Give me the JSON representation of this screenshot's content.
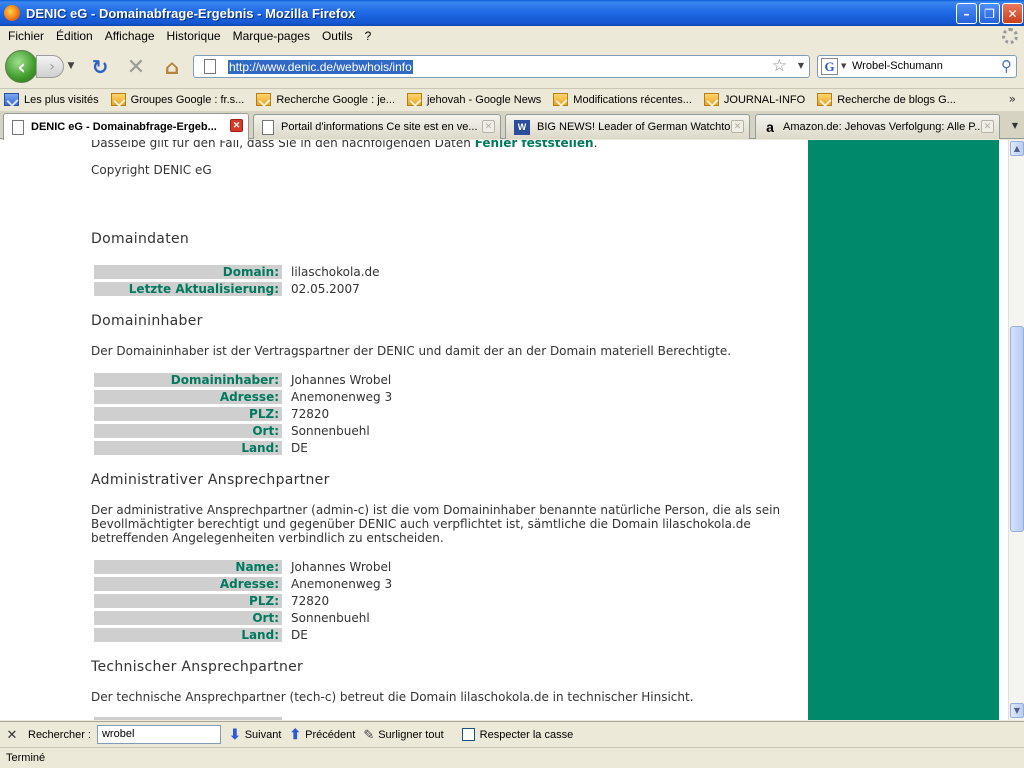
{
  "window": {
    "title": "DENIC eG - Domainabfrage-Ergebnis - Mozilla Firefox"
  },
  "menu": [
    "Fichier",
    "Édition",
    "Affichage",
    "Historique",
    "Marque-pages",
    "Outils",
    "?"
  ],
  "navigation": {
    "url": "http://www.denic.de/webwhois/info",
    "search_value": "Wrobel-Schumann",
    "search_engine_glyph": "G"
  },
  "bookmarks": [
    "Les plus visités",
    "Groupes Google : fr.s...",
    "Recherche Google : je...",
    "jehovah - Google News",
    "Modifications récentes...",
    "JOURNAL-INFO",
    "Recherche de blogs G..."
  ],
  "tabs": [
    {
      "label": "DENIC eG - Domainabfrage-Ergeb...",
      "active": true
    },
    {
      "label": "Portail d'informations Ce site est en ve...",
      "active": false
    },
    {
      "label": "BIG NEWS! Leader of German Watchto...",
      "active": false
    },
    {
      "label": "Amazon.de: Jehovas Verfolgung: Alle P...",
      "active": false
    }
  ],
  "content": {
    "cut_line_prefix": "Dasselbe gilt für den Fall, dass Sie in den nachfolgenden Daten ",
    "cut_line_link": "Fehler feststellen",
    "cut_line_suffix": ".",
    "copyright": "Copyright DENIC eG",
    "domaindaten": {
      "heading": "Domaindaten",
      "rows": [
        {
          "key": "Domain:",
          "value": "lilaschokola.de"
        },
        {
          "key": "Letzte Aktualisierung:",
          "value": "02.05.2007"
        }
      ]
    },
    "domaininhaber": {
      "heading": "Domaininhaber",
      "description": "Der Domaininhaber ist der Vertragspartner der DENIC und damit der an der Domain materiell Berechtigte.",
      "rows": [
        {
          "key": "Domaininhaber:",
          "value": "Johannes Wrobel"
        },
        {
          "key": "Adresse:",
          "value": "Anemonenweg 3"
        },
        {
          "key": "PLZ:",
          "value": "72820"
        },
        {
          "key": "Ort:",
          "value": "Sonnenbuehl"
        },
        {
          "key": "Land:",
          "value": "DE"
        }
      ]
    },
    "admin": {
      "heading": "Administrativer Ansprechpartner",
      "description": "Der administrative Ansprechpartner (admin-c) ist die vom Domaininhaber benannte natürliche Person, die als sein Bevollmächtigter berechtigt und gegenüber DENIC auch verpflichtet ist, sämtliche die Domain lilaschokola.de betreffenden Angelegenheiten verbindlich zu entscheiden.",
      "rows": [
        {
          "key": "Name:",
          "value": "Johannes Wrobel"
        },
        {
          "key": "Adresse:",
          "value": "Anemonenweg 3"
        },
        {
          "key": "PLZ:",
          "value": "72820"
        },
        {
          "key": "Ort:",
          "value": "Sonnenbuehl"
        },
        {
          "key": "Land:",
          "value": "DE"
        }
      ]
    },
    "tech": {
      "heading": "Technischer Ansprechpartner",
      "description": "Der technische Ansprechpartner (tech-c) betreut die Domain lilaschokola.de in technischer Hinsicht."
    }
  },
  "findbar": {
    "label": "Rechercher :",
    "value": "wrobel",
    "next": "Suivant",
    "previous": "Précédent",
    "highlight": "Surligner tout",
    "match_case": "Respecter la casse"
  },
  "status": "Terminé",
  "colors": {
    "accent_green": "#00896a",
    "link_green": "#00795e",
    "label_bg": "#cfcfcf"
  }
}
